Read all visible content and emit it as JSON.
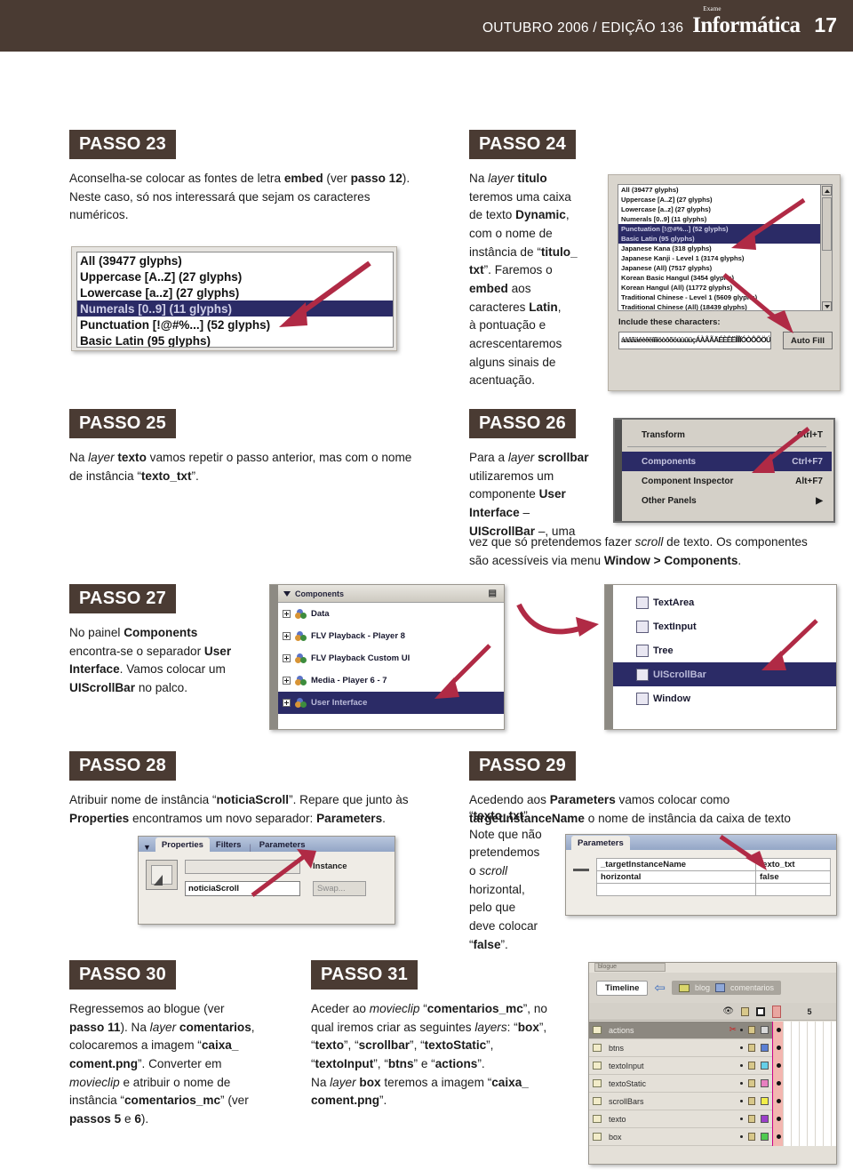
{
  "header": {
    "issue": "OUTUBRO 2006 / EDIÇÃO 136",
    "logo_sub": "Exame",
    "logo_main": "Informática",
    "page_number": "17",
    "bar_color": "#4a3b33"
  },
  "steps": {
    "s23": {
      "badge": "PASSO 23",
      "line1_a": "Aconselha-se colocar as fontes de letra ",
      "line1_b": "embed",
      "line1_c": " (ver ",
      "line1_d": "passo 12",
      "line1_e": ").",
      "line2": "Neste caso, só nos interessará que sejam os caracteres",
      "line3": "numéricos."
    },
    "s24": {
      "badge": "PASSO 24",
      "t1": "Na ",
      "t2": "layer",
      "t3": " titulo",
      "t4": "teremos uma caixa",
      "t5": "de texto ",
      "t6": "Dynamic",
      "t7": ",",
      "t8": "com o nome de",
      "t9": "instância de “",
      "t10": "titulo_",
      "t11": "txt",
      "t12": "”. Faremos o",
      "t13": "embed",
      "t14": " aos",
      "t15": "caracteres ",
      "t16": "Latin",
      "t17": ",",
      "t18": "à pontuação e",
      "t19": "acrescentaremos",
      "t20": "alguns sinais de",
      "t21": "acentuação."
    },
    "s25": {
      "badge": "PASSO 25",
      "t1": "Na ",
      "t2": "layer",
      "t3": " texto",
      "t4": " vamos repetir o passo anterior, mas com o nome",
      "t5": "de instância “",
      "t6": "texto_txt",
      "t7": "”."
    },
    "s26": {
      "badge": "PASSO 26",
      "t1": "Para a ",
      "t2": "layer",
      "t3": " scrollbar",
      "t4": "utilizaremos um",
      "t5": "componente ",
      "t6": "User",
      "t7": "Interface",
      "t8": " –",
      "t9": "UIScrollBar",
      "t10": " –, uma",
      "t11": "vez que só pretendemos fazer ",
      "t12": "scroll",
      "t13": " de texto. Os componentes",
      "t14": "são acessíveis via menu ",
      "t15": "Window > Components",
      "t16": "."
    },
    "s27": {
      "badge": "PASSO 27",
      "t1": "No painel ",
      "t2": "Components",
      "t3": "encontra-se o separador ",
      "t4": "User",
      "t5": "Interface",
      "t6": ". Vamos colocar um",
      "t7": "UIScrollBar",
      "t8": " no palco."
    },
    "s28": {
      "badge": "PASSO 28",
      "t1": "Atribuir nome de instância “",
      "t2": "noticiaScroll",
      "t3": "”. Repare que junto às",
      "t4": "Properties",
      "t5": " encontramos um novo separador: ",
      "t6": "Parameters",
      "t7": "."
    },
    "s29": {
      "badge": "PASSO 29",
      "t1": "Acedendo aos ",
      "t2": "Parameters",
      "t3": " vamos colocar como",
      "t4": "targetInstanceName",
      "t5": " o nome de instância da caixa de texto",
      "t6": "“",
      "t7": "texto_txt",
      "t8": "”.",
      "t9": "Note que não",
      "t10": "pretendemos",
      "t11": "o ",
      "t12": "scroll",
      "t13": "horizontal,",
      "t14": "pelo que",
      "t15": "deve colocar “",
      "t16": "false",
      "t17": "”."
    },
    "s30": {
      "badge": "PASSO 30",
      "t1": "Regressemos ao blogue (ver",
      "t2": "passo 11",
      "t3": "). Na ",
      "t4": "layer",
      "t5": " comentarios",
      "t6": ",",
      "t7": "colocaremos a imagem “",
      "t8": "caixa_",
      "t9": "coment.png",
      "t10": "”. Converter em",
      "t11": "movieclip",
      "t12": " e atribuir o nome de",
      "t13": "instância “",
      "t14": "comentarios_mc",
      "t15": "” (ver",
      "t16": "passos 5",
      "t17": " e ",
      "t18": "6",
      "t19": ")."
    },
    "s31": {
      "badge": "PASSO 31",
      "t1": "Aceder ao ",
      "t2": "movieclip",
      "t3": " “",
      "t4": "comentarios_mc",
      "t5": "”, no",
      "t6": "qual iremos criar as seguintes ",
      "t7": "layers",
      "t8": ": “",
      "t9": "box",
      "t10": "”,",
      "t11": "“",
      "t12": "texto",
      "t13": "”, “",
      "t14": "scrollbar",
      "t15": "”, “",
      "t16": "textoStatic",
      "t17": "”,",
      "t18": "“",
      "t19": "textoInput",
      "t20": "”, “",
      "t21": "btns",
      "t22": "” e “",
      "t23": "actions",
      "t24": "”.",
      "t25": "Na ",
      "t26": "layer",
      "t27": " box",
      "t28": " teremos a imagem “",
      "t29": "caixa_",
      "t30": "coment.png",
      "t31": "”."
    }
  },
  "shots": {
    "glyph_list_23": {
      "items": [
        "All  (39477 glyphs)",
        "Uppercase [A..Z]  (27 glyphs)",
        "Lowercase [a..z]  (27 glyphs)",
        "Numerals [0..9]  (11 glyphs)",
        "Punctuation [!@#%...] (52 glyphs)",
        "Basic Latin  (95 glyphs)"
      ],
      "selected_index": 3
    },
    "embed_dialog_24": {
      "items": [
        "All  (39477 glyphs)",
        "Uppercase [A..Z]  (27 glyphs)",
        "Lowercase [a..z]  (27 glyphs)",
        "Numerals [0..9]  (11 glyphs)",
        "Punctuation [!@#%...] (52 glyphs)",
        "Basic Latin  (95 glyphs)",
        "Japanese Kana  (318 glyphs)",
        "Japanese Kanji - Level 1 (3174 glyphs)",
        "Japanese (All)  (7517 glyphs)",
        "Korean Basic Hangul (3454 glyphs)",
        "Korean Hangul (All) (11772 glyphs)",
        "Traditional Chinese - Level 1 (5609 glyphs)",
        "Traditional Chinese (All)  (18439 glyphs)"
      ],
      "selected_indices": [
        4,
        5
      ],
      "include_label": "Include these characters:",
      "include_value": "áàâãäéèêëíìîïóòôõöúùûüçÁÀÂÃÄÉÈÊËÍÌÎÏÓÒÔÕÖÚÙÛÜÇ",
      "autofill_label": "Auto Fill"
    },
    "window_menu_26": {
      "items": [
        {
          "label": "Transform",
          "shortcut": "Ctrl+T",
          "selected": false,
          "submenu": false
        },
        {
          "label": "Components",
          "shortcut": "Ctrl+F7",
          "selected": true,
          "submenu": false
        },
        {
          "label": "Component Inspector",
          "shortcut": "Alt+F7",
          "selected": false,
          "submenu": false
        },
        {
          "label": "Other Panels",
          "shortcut": "",
          "selected": false,
          "submenu": true
        }
      ]
    },
    "components_panel_27": {
      "title": "Components",
      "items": [
        {
          "label": "Data",
          "selected": false
        },
        {
          "label": "FLV Playback - Player 8",
          "selected": false
        },
        {
          "label": "FLV Playback Custom UI",
          "selected": false
        },
        {
          "label": "Media - Player 6 - 7",
          "selected": false
        },
        {
          "label": "User Interface",
          "selected": true
        }
      ]
    },
    "ui_list_27": {
      "items": [
        {
          "label": "TextArea",
          "selected": false
        },
        {
          "label": "TextInput",
          "selected": false
        },
        {
          "label": "Tree",
          "selected": false
        },
        {
          "label": "UIScrollBar",
          "selected": true
        },
        {
          "label": "Window",
          "selected": false
        }
      ]
    },
    "properties_panel_28": {
      "tabs": [
        "Properties",
        "Filters",
        "Parameters"
      ],
      "active_tab": "Properties",
      "instance_value": "noticiaScroll",
      "instance_label": "Instance",
      "swap_label": "Swap..."
    },
    "parameters_panel_29": {
      "tab": "Parameters",
      "rows": [
        {
          "name": "_targetInstanceName",
          "value": "texto_txt"
        },
        {
          "name": "horizontal",
          "value": "false"
        }
      ]
    },
    "timeline_31": {
      "tab": "Timeline",
      "crumbs": [
        "blog",
        "comentarios"
      ],
      "frame_label": "5",
      "layers": [
        {
          "name": "actions",
          "color": "#d9d9d9",
          "selected": true
        },
        {
          "name": "btns",
          "color": "#5b7fd4",
          "selected": false
        },
        {
          "name": "textoInput",
          "color": "#66cfe8",
          "selected": false
        },
        {
          "name": "textoStatic",
          "color": "#e87fc0",
          "selected": false
        },
        {
          "name": "scrollBars",
          "color": "#f2ee4a",
          "selected": false
        },
        {
          "name": "texto",
          "color": "#9b3fc9",
          "selected": false
        },
        {
          "name": "box",
          "color": "#4fcb4f",
          "selected": false
        }
      ]
    }
  }
}
